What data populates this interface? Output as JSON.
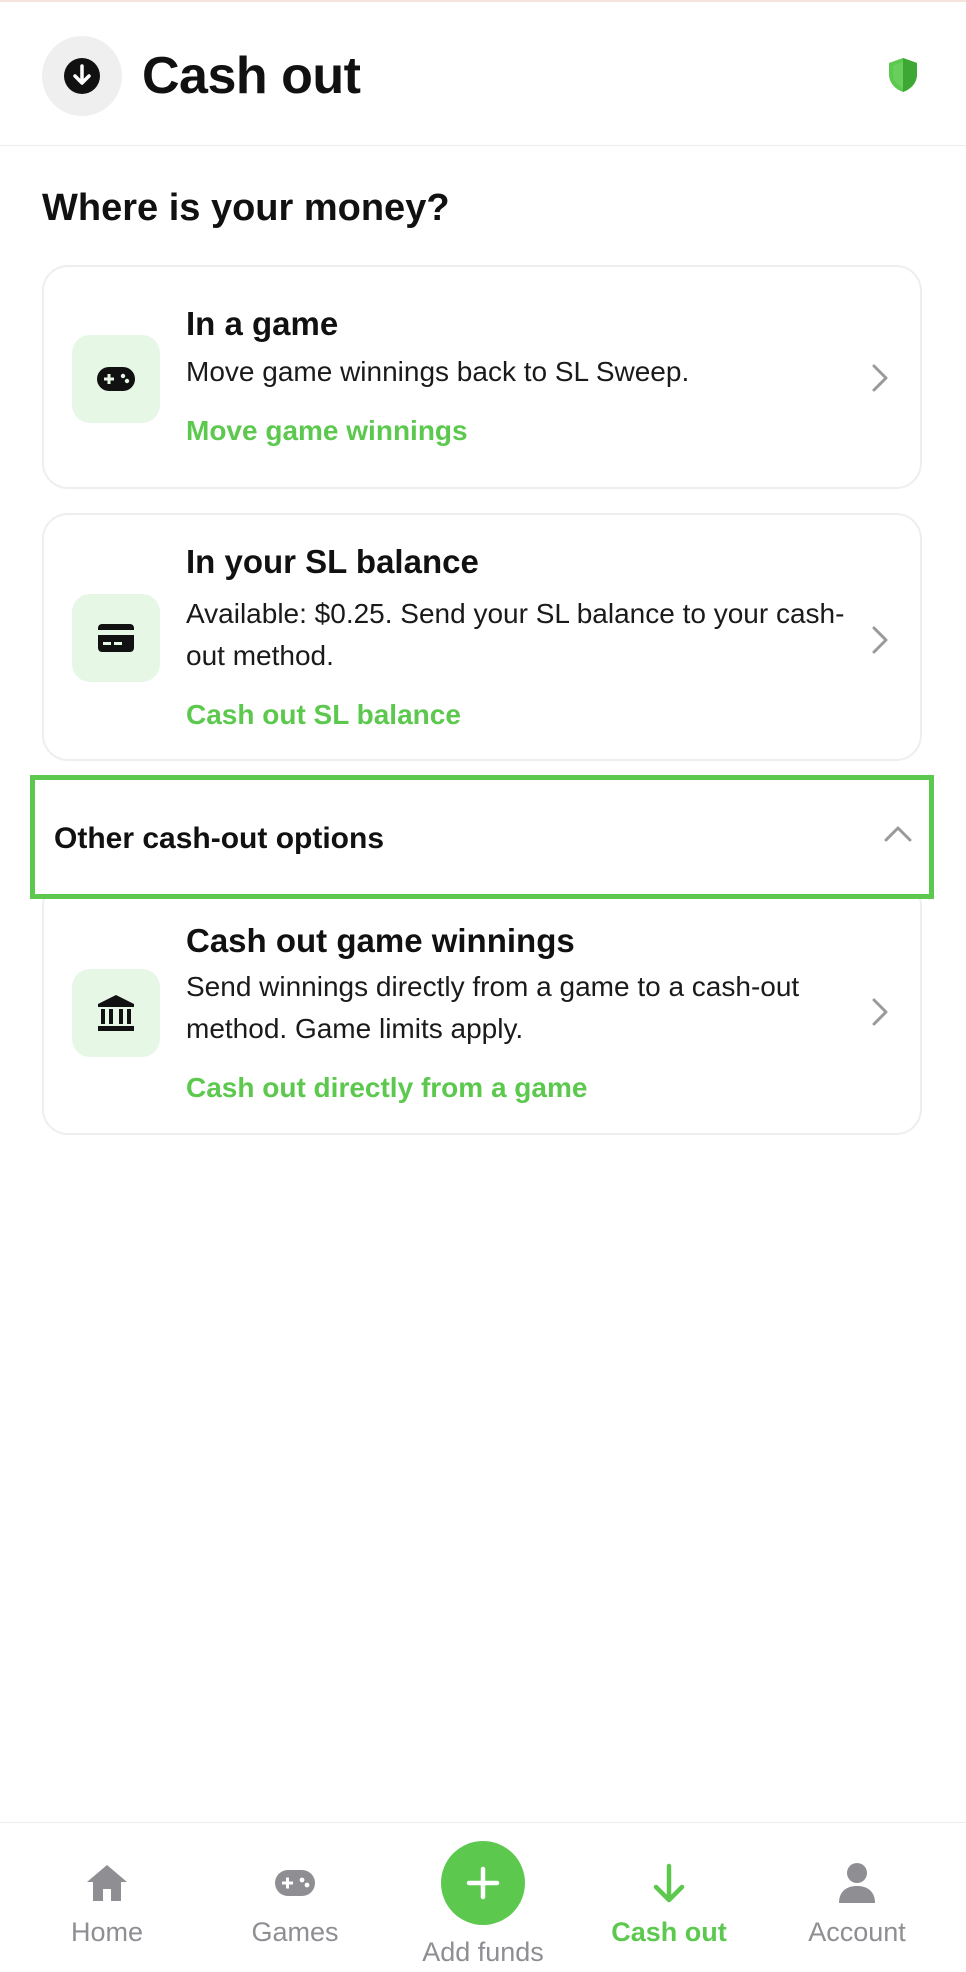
{
  "header": {
    "title": "Cash out",
    "left_icon": "download-circle-icon",
    "right_icon": "shield-icon"
  },
  "main": {
    "heading": "Where is your money?",
    "cards": [
      {
        "icon": "gamepad-icon",
        "title": "In a game",
        "description": "Move game winnings back to SL Sweep.",
        "link": "Move game winnings"
      },
      {
        "icon": "credit-card-icon",
        "title": "In your SL balance",
        "description": "Available: $0.25. Send your SL balance to your cash-out method.",
        "link": "Cash out SL balance"
      }
    ],
    "other_options": {
      "label": "Other cash-out options",
      "expanded": true,
      "cards": [
        {
          "icon": "bank-icon",
          "title": "Cash out game winnings",
          "description": "Send winnings directly from a game to a cash-out method. Game limits apply.",
          "link": "Cash out directly from a game"
        }
      ]
    }
  },
  "bottom_nav": {
    "items": [
      {
        "label": "Home",
        "icon": "home-icon"
      },
      {
        "label": "Games",
        "icon": "gamepad-icon"
      },
      {
        "label": "Add funds",
        "icon": "plus-icon"
      },
      {
        "label": "Cash out",
        "icon": "arrow-down-icon",
        "active": true
      },
      {
        "label": "Account",
        "icon": "person-icon"
      }
    ]
  },
  "colors": {
    "accent": "#5cc94e",
    "icon_bg": "#e6f7e6",
    "inactive": "#8e8e93"
  }
}
